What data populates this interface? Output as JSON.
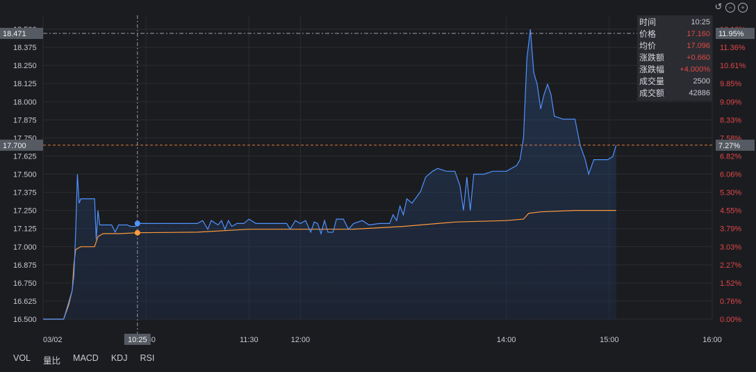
{
  "info_panel": {
    "rows": [
      {
        "label": "时间",
        "value": "10:25"
      },
      {
        "label": "价格",
        "value": "17.160"
      },
      {
        "label": "均价",
        "value": "17.096"
      },
      {
        "label": "涨跌额",
        "value": "+0.660"
      },
      {
        "label": "涨跌幅",
        "value": "+4.000%"
      },
      {
        "label": "成交量",
        "value": "2500"
      },
      {
        "label": "成交额",
        "value": "42886"
      }
    ]
  },
  "indicator_tabs": [
    "VOL",
    "量比",
    "MACD",
    "KDJ",
    "RSI"
  ],
  "colors": {
    "price": "#4f93ff",
    "avg": "#ff9a3c",
    "up": "#e04848",
    "crosshair": "#9aa0aa",
    "ref": "#e07a3a"
  },
  "icons": [
    "undo-icon",
    "zoom-out-icon",
    "zoom-in-icon"
  ],
  "chart_data": {
    "type": "line",
    "ylim": [
      16.5,
      18.5
    ],
    "y_ticks": [
      "16.500",
      "16.625",
      "16.750",
      "16.875",
      "17.000",
      "17.125",
      "17.250",
      "17.375",
      "17.500",
      "17.625",
      "17.750",
      "17.875",
      "18.000",
      "18.125",
      "18.250",
      "18.375",
      "18.500"
    ],
    "pct_ticks": [
      "0.00%",
      "0.76%",
      "1.52%",
      "2.27%",
      "3.03%",
      "3.79%",
      "4.55%",
      "5.30%",
      "6.06%",
      "6.82%",
      "7.58%",
      "8.33%",
      "9.09%",
      "9.85%",
      "10.61%",
      "11.36%",
      "12.12%"
    ],
    "x_ticks": [
      "03/02",
      "10:30",
      "11:30",
      "12:00",
      "14:00",
      "15:00",
      "16:00"
    ],
    "x_tick_times": [
      "09:30",
      "10:30",
      "11:30",
      "12:00",
      "14:00",
      "15:00",
      "16:00"
    ],
    "xlim": [
      "09:30",
      "16:00"
    ],
    "crosshair": {
      "time": "10:25",
      "price": 17.16,
      "avg": 17.096,
      "label": "10:25"
    },
    "hover_level": {
      "price": 18.471,
      "label": "18.471",
      "pct_label": "11.95%"
    },
    "ref_level": {
      "price": 17.7,
      "label": "17.700",
      "pct_label": "7.27%"
    },
    "series": [
      {
        "key": "price",
        "points": [
          [
            "09:30",
            16.5
          ],
          [
            "09:33",
            16.5
          ],
          [
            "09:42",
            16.5
          ],
          [
            "09:45",
            16.62
          ],
          [
            "09:47",
            16.7
          ],
          [
            "09:48",
            16.8
          ],
          [
            "09:49",
            17.1
          ],
          [
            "09:50",
            17.5
          ],
          [
            "09:51",
            17.3
          ],
          [
            "09:52",
            17.33
          ],
          [
            "10:00",
            17.33
          ],
          [
            "10:01",
            17.05
          ],
          [
            "10:02",
            17.25
          ],
          [
            "10:03",
            17.15
          ],
          [
            "10:10",
            17.15
          ],
          [
            "10:12",
            17.1
          ],
          [
            "10:14",
            17.15
          ],
          [
            "10:19",
            17.15
          ],
          [
            "10:21",
            17.14
          ],
          [
            "10:24",
            17.14
          ],
          [
            "10:25",
            17.16
          ],
          [
            "10:45",
            17.16
          ],
          [
            "11:00",
            17.16
          ],
          [
            "11:03",
            17.18
          ],
          [
            "11:06",
            17.12
          ],
          [
            "11:08",
            17.18
          ],
          [
            "11:12",
            17.15
          ],
          [
            "11:14",
            17.18
          ],
          [
            "11:16",
            17.12
          ],
          [
            "11:18",
            17.18
          ],
          [
            "11:20",
            17.14
          ],
          [
            "11:23",
            17.16
          ],
          [
            "11:27",
            17.16
          ],
          [
            "11:30",
            17.19
          ],
          [
            "11:34",
            17.16
          ],
          [
            "11:52",
            17.16
          ],
          [
            "11:54",
            17.12
          ],
          [
            "11:57",
            17.18
          ],
          [
            "12:00",
            17.16
          ],
          [
            "12:03",
            17.18
          ],
          [
            "12:06",
            17.1
          ],
          [
            "12:08",
            17.17
          ],
          [
            "12:10",
            17.16
          ],
          [
            "12:12",
            17.09
          ],
          [
            "12:14",
            17.18
          ],
          [
            "12:16",
            17.1
          ],
          [
            "12:19",
            17.1
          ],
          [
            "12:21",
            17.19
          ],
          [
            "12:25",
            17.19
          ],
          [
            "12:28",
            17.12
          ],
          [
            "12:31",
            17.16
          ],
          [
            "12:36",
            17.18
          ],
          [
            "12:40",
            17.15
          ],
          [
            "12:46",
            17.16
          ],
          [
            "12:52",
            17.16
          ],
          [
            "12:54",
            17.22
          ],
          [
            "12:56",
            17.18
          ],
          [
            "12:58",
            17.28
          ],
          [
            "13:00",
            17.22
          ],
          [
            "13:02",
            17.33
          ],
          [
            "13:05",
            17.3
          ],
          [
            "13:10",
            17.38
          ],
          [
            "13:13",
            17.48
          ],
          [
            "13:17",
            17.52
          ],
          [
            "13:20",
            17.54
          ],
          [
            "13:25",
            17.52
          ],
          [
            "13:30",
            17.52
          ],
          [
            "13:33",
            17.42
          ],
          [
            "13:35",
            17.25
          ],
          [
            "13:37",
            17.48
          ],
          [
            "13:39",
            17.25
          ],
          [
            "13:41",
            17.5
          ],
          [
            "13:47",
            17.5
          ],
          [
            "13:52",
            17.52
          ],
          [
            "13:57",
            17.52
          ],
          [
            "14:00",
            17.52
          ],
          [
            "14:06",
            17.56
          ],
          [
            "14:08",
            17.6
          ],
          [
            "14:10",
            17.75
          ],
          [
            "14:12",
            18.3
          ],
          [
            "14:14",
            18.5
          ],
          [
            "14:16",
            18.2
          ],
          [
            "14:18",
            18.12
          ],
          [
            "14:20",
            17.95
          ],
          [
            "14:22",
            18.05
          ],
          [
            "14:24",
            18.12
          ],
          [
            "14:26",
            18.05
          ],
          [
            "14:28",
            17.9
          ],
          [
            "14:33",
            17.88
          ],
          [
            "14:40",
            17.88
          ],
          [
            "14:43",
            17.7
          ],
          [
            "14:46",
            17.6
          ],
          [
            "14:48",
            17.5
          ],
          [
            "14:51",
            17.6
          ],
          [
            "14:59",
            17.6
          ],
          [
            "15:02",
            17.62
          ],
          [
            "15:04",
            17.7
          ]
        ]
      },
      {
        "key": "avg",
        "points": [
          [
            "09:30",
            16.5
          ],
          [
            "09:42",
            16.5
          ],
          [
            "09:45",
            16.6
          ],
          [
            "09:47",
            16.7
          ],
          [
            "09:48",
            16.88
          ],
          [
            "09:49",
            16.98
          ],
          [
            "09:52",
            17.0
          ],
          [
            "10:00",
            17.0
          ],
          [
            "10:02",
            17.07
          ],
          [
            "10:05",
            17.09
          ],
          [
            "10:15",
            17.09
          ],
          [
            "10:25",
            17.096
          ],
          [
            "11:00",
            17.1
          ],
          [
            "11:30",
            17.12
          ],
          [
            "12:00",
            17.12
          ],
          [
            "12:30",
            17.12
          ],
          [
            "13:00",
            17.14
          ],
          [
            "13:30",
            17.17
          ],
          [
            "14:00",
            17.18
          ],
          [
            "14:10",
            17.19
          ],
          [
            "14:13",
            17.23
          ],
          [
            "14:20",
            17.24
          ],
          [
            "14:40",
            17.25
          ],
          [
            "15:04",
            17.25
          ]
        ]
      }
    ]
  }
}
